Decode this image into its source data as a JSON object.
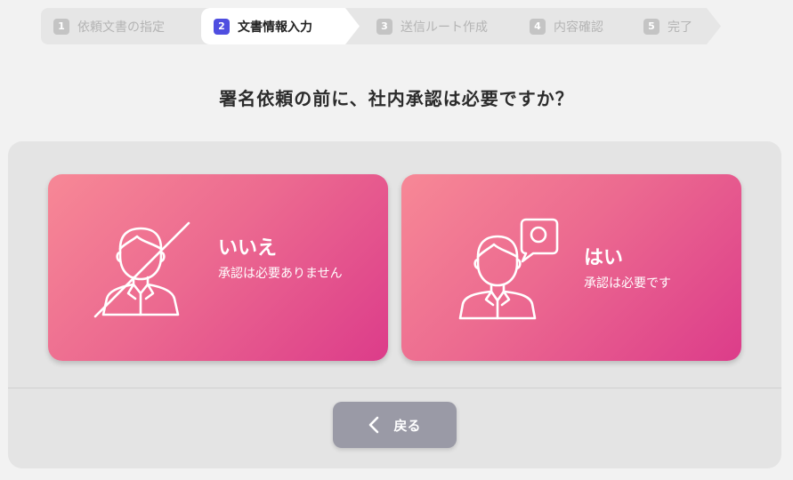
{
  "stepper": {
    "steps": [
      {
        "num": "1",
        "label": "依頼文書の指定"
      },
      {
        "num": "2",
        "label": "文書情報入力"
      },
      {
        "num": "3",
        "label": "送信ルート作成"
      },
      {
        "num": "4",
        "label": "内容確認"
      },
      {
        "num": "5",
        "label": "完了"
      }
    ],
    "active_step": 2
  },
  "question": "署名依頼の前に、社内承認は必要ですか？",
  "options": {
    "no": {
      "title": "いいえ",
      "subtitle": "承認は必要ありません",
      "icon": "person-crossed-out-icon"
    },
    "yes": {
      "title": "はい",
      "subtitle": "承認は必要です",
      "icon": "person-speech-bubble-icon"
    }
  },
  "back_button": {
    "label": "戻る",
    "icon": "chevron-left-icon"
  },
  "colors": {
    "accent": "#4f4ee0",
    "card_gradient_start": "#f78896",
    "card_gradient_end": "#dc3c8a",
    "back_button": "#9a9aa6"
  }
}
